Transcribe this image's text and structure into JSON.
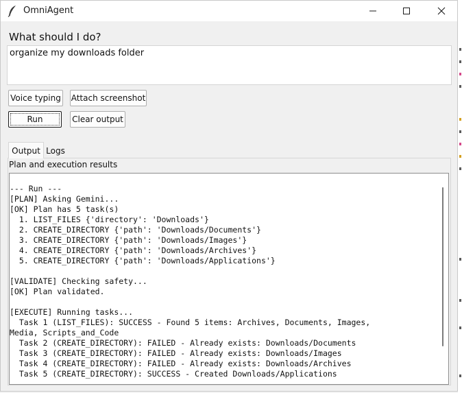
{
  "window": {
    "title": "OmniAgent",
    "icon": "feather-icon",
    "controls": [
      "minimize-icon",
      "maximize-icon",
      "close-icon"
    ]
  },
  "prompt": {
    "label": "What should I do?",
    "value": "organize my downloads folder"
  },
  "buttons": {
    "voice": "Voice typing",
    "attach": "Attach screenshot",
    "run": "Run",
    "clear": "Clear output"
  },
  "tabs": [
    {
      "label": "Output",
      "active": true
    },
    {
      "label": "Logs",
      "active": false
    }
  ],
  "output_panel": {
    "label": "Plan and execution results",
    "lines": [
      "",
      "--- Run ---",
      "[PLAN] Asking Gemini...",
      "[OK] Plan has 5 task(s)",
      "  1. LIST_FILES {'directory': 'Downloads'}",
      "  2. CREATE_DIRECTORY {'path': 'Downloads/Documents'}",
      "  3. CREATE_DIRECTORY {'path': 'Downloads/Images'}",
      "  4. CREATE_DIRECTORY {'path': 'Downloads/Archives'}",
      "  5. CREATE_DIRECTORY {'path': 'Downloads/Applications'}",
      "",
      "[VALIDATE] Checking safety...",
      "[OK] Plan validated.",
      "",
      "[EXECUTE] Running tasks...",
      "  Task 1 (LIST_FILES): SUCCESS - Found 5 items: Archives, Documents, Images,",
      "Media, Scripts_and_Code",
      "  Task 2 (CREATE_DIRECTORY): FAILED - Already exists: Downloads/Documents",
      "  Task 3 (CREATE_DIRECTORY): FAILED - Already exists: Downloads/Images",
      "  Task 4 (CREATE_DIRECTORY): FAILED - Already exists: Downloads/Archives",
      "  Task 5 (CREATE_DIRECTORY): SUCCESS - Created Downloads/Applications"
    ]
  },
  "colors": {
    "window_bg": "#f0f0f0",
    "titlebar_bg": "#ffffff",
    "button_border": "#adadad",
    "text": "#111111"
  }
}
